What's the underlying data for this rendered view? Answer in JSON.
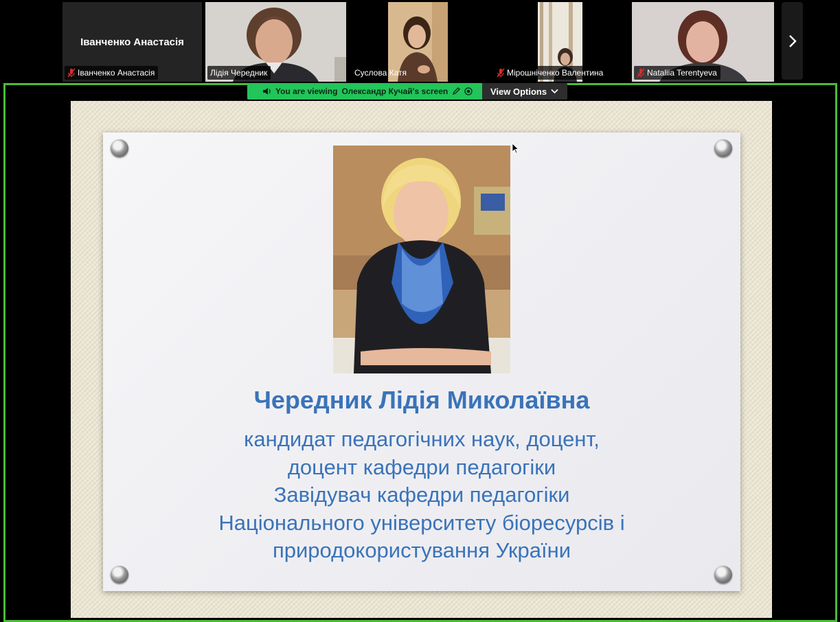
{
  "gallery": {
    "participants": [
      {
        "name": "Іванченко Анастасія",
        "display_name": "Іванченко Анастасія",
        "muted": true,
        "video": false
      },
      {
        "name": "Лідія Чередник",
        "muted": false,
        "video": true,
        "active_speaker": true
      },
      {
        "name": "Суслова Катя",
        "muted": false,
        "video": true
      },
      {
        "name": "Мірошніченко Валентина",
        "muted": true,
        "video": true
      },
      {
        "name": "Nataliia Terentyeva",
        "muted": true,
        "video": true
      }
    ]
  },
  "share": {
    "banner_prefix": "You are viewing",
    "banner_presenter": "Олександр Кучай's screen",
    "view_options": "View Options"
  },
  "slide": {
    "title": "Чередник Лідія Миколаївна",
    "lines": [
      "кандидат педагогічних наук, доцент,",
      "доцент кафедри педагогіки",
      "Завідувач кафедри педагогіки",
      "Національного університету біоресурсів і",
      "природокористування України"
    ]
  },
  "colors": {
    "active_border": "#4cbb38",
    "banner_green": "#23c45a",
    "slide_text": "#3a73b9",
    "mute_red": "#e02828"
  }
}
